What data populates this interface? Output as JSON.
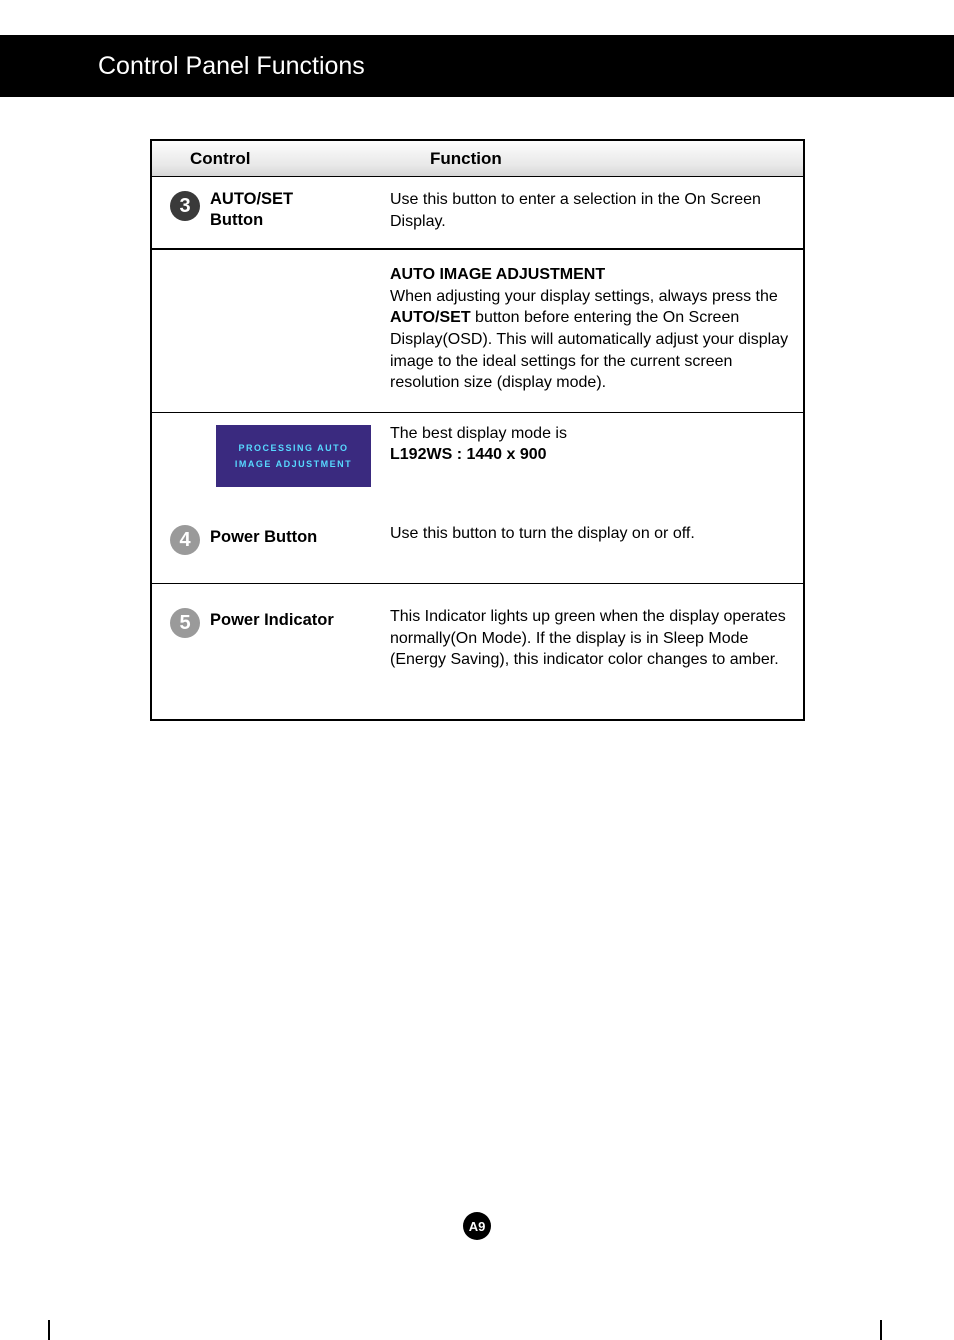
{
  "header": {
    "title": "Control Panel Functions"
  },
  "columns": {
    "c1": "Control",
    "c2": "Function"
  },
  "rows": {
    "r3": {
      "num": "3",
      "name_l1": "AUTO/SET",
      "name_l2": "Button",
      "desc": "Use this button to enter a selection in the On Screen Display.",
      "sub_title": "AUTO IMAGE ADJUSTMENT",
      "sub_body_a": "When adjusting your display settings, always press the ",
      "sub_body_bold": "AUTO/SET",
      "sub_body_b": " button before entering the On Screen Display(OSD). This will automatically adjust your display image to the ideal settings for the current screen resolution size (display mode).",
      "osd_l1": "PROCESSING AUTO",
      "osd_l2": "IMAGE ADJUSTMENT",
      "mode_intro": "The best display mode is",
      "mode_value": "L192WS : 1440 x 900"
    },
    "r4": {
      "num": "4",
      "name": "Power Button",
      "desc": "Use this button to turn the display on or off."
    },
    "r5": {
      "num": "5",
      "name": "Power Indicator",
      "desc": "This Indicator lights up green when the display operates normally(On Mode). If the display is in Sleep Mode (Energy Saving), this indicator color changes to amber."
    }
  },
  "page": "A9"
}
